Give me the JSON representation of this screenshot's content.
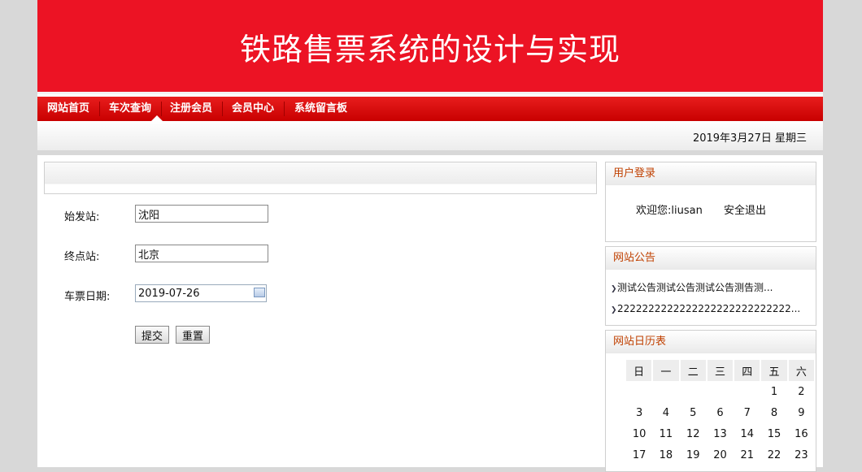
{
  "banner": {
    "title": "铁路售票系统的设计与实现"
  },
  "nav": {
    "items": [
      "网站首页",
      "车次查询",
      "注册会员",
      "会员中心",
      "系统留言板"
    ],
    "active": "车次查询"
  },
  "datebar": {
    "date": "2019年3月27日 星期三"
  },
  "form": {
    "from_label": "始发站:",
    "from_value": "沈阳",
    "to_label": "终点站:",
    "to_value": "北京",
    "date_label": "车票日期:",
    "date_value": "2019-07-26",
    "submit_label": "提交",
    "reset_label": "重置"
  },
  "login": {
    "title": "用户登录",
    "welcome": "欢迎您:",
    "username": "liusan",
    "logout": "安全退出"
  },
  "notice": {
    "title": "网站公告",
    "items": [
      "测试公告测试公告测试公告测告测...",
      "2222222222222222222222222222..."
    ]
  },
  "calendar": {
    "title": "网站日历表",
    "weekdays": [
      "日",
      "一",
      "二",
      "三",
      "四",
      "五",
      "六"
    ],
    "weeks": [
      [
        "",
        "",
        "",
        "",
        "",
        "1",
        "2"
      ],
      [
        "3",
        "4",
        "5",
        "6",
        "7",
        "8",
        "9"
      ],
      [
        "10",
        "11",
        "12",
        "13",
        "14",
        "15",
        "16"
      ],
      [
        "17",
        "18",
        "19",
        "20",
        "21",
        "22",
        "23"
      ]
    ]
  },
  "colors": {
    "banner": "#ec1324",
    "nav": "#d40000",
    "side_title": "#c04000"
  }
}
